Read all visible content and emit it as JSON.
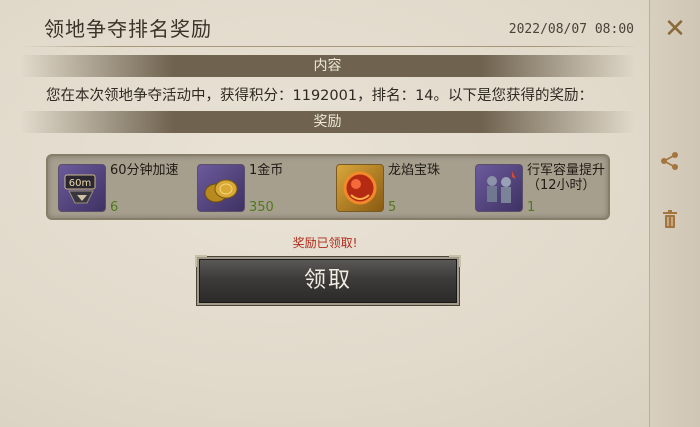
{
  "header": {
    "title": "领地争夺排名奖励",
    "datetime": "2022/08/07 08:00",
    "close_icon": "close-x-icon"
  },
  "sections": {
    "content_label": "内容",
    "reward_label": "奖励"
  },
  "message": "您在本次领地争夺活动中，获得积分：1192001，排名：14。以下是您获得的奖励：",
  "rewards": [
    {
      "name": "60分钟加速",
      "count": "6",
      "icon": "speedup-60m-icon",
      "icon_text": "60m"
    },
    {
      "name": "1金币",
      "count": "350",
      "icon": "gold-coin-icon"
    },
    {
      "name": "龙焰宝珠",
      "count": "5",
      "icon": "dragon-flame-orb-icon"
    },
    {
      "name": "行军容量提升（12小时）",
      "count": "1",
      "icon": "march-capacity-icon"
    }
  ],
  "status_text": "奖励已领取!",
  "claim_button_label": "领取",
  "side_actions": [
    "share-icon",
    "trash-icon"
  ],
  "colors": {
    "count_green": "#4f7a1e",
    "status_red": "#b02a1a",
    "accent_gold": "#a5753f"
  }
}
